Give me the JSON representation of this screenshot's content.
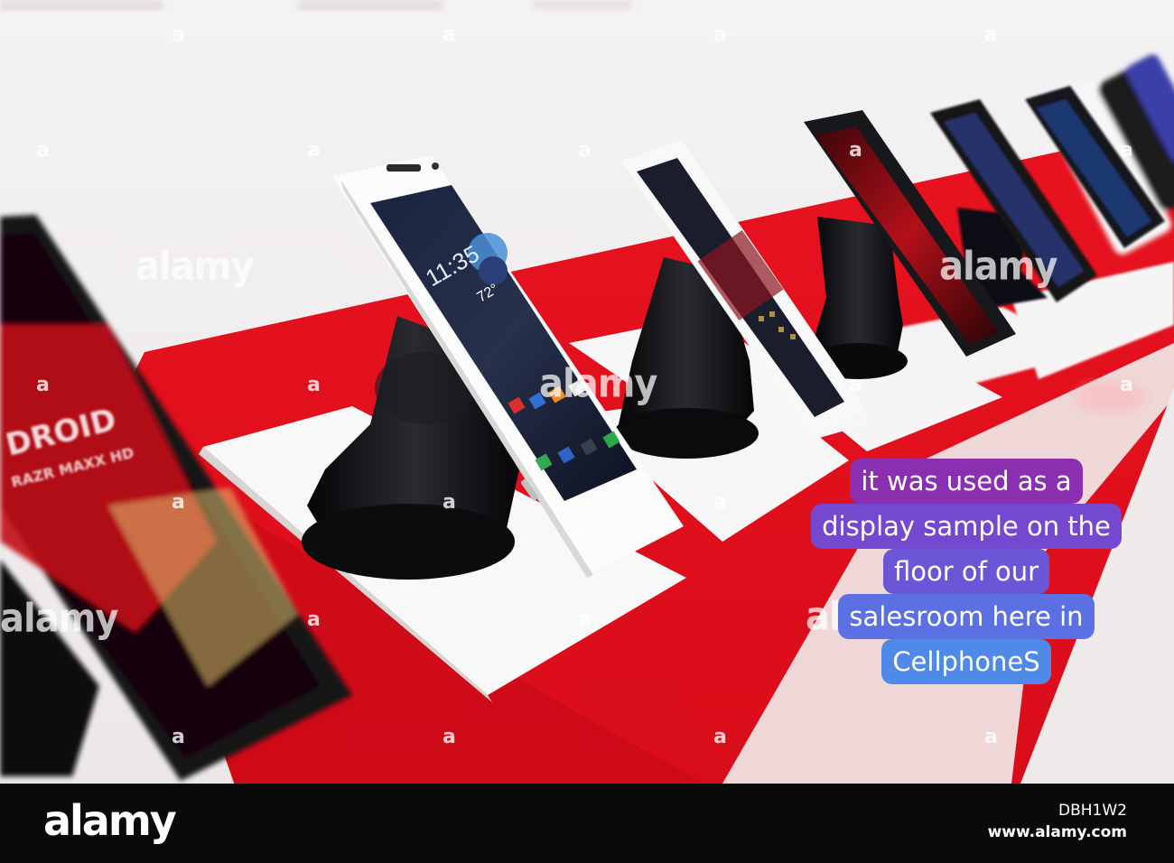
{
  "photo": {
    "subject": "Smartphones on black display stands along a red counter",
    "colors": {
      "counter": "#e0101c",
      "wall": "#f1eef0",
      "stand": "#101014",
      "phone_white": "#f8f8f8",
      "phone_black": "#15161a"
    }
  },
  "phone_labels": {
    "main_time": "11:35",
    "main_temp": "72°",
    "blurred_brand": "DROID",
    "blurred_model": "RAZR MAXX HD"
  },
  "caption": {
    "lines": [
      "it was used as a",
      "display sample on the",
      "floor of our",
      "salesroom here in",
      "CellphoneS"
    ],
    "colors": {
      "top": "#8a2fb0",
      "middle": "#6b56d8",
      "bottom": "#4f8ae8"
    }
  },
  "watermark": {
    "text": "alamy",
    "dot": "a"
  },
  "footer": {
    "logo": "alamy",
    "image_id": "DBH1W2",
    "url": "www.alamy.com"
  }
}
